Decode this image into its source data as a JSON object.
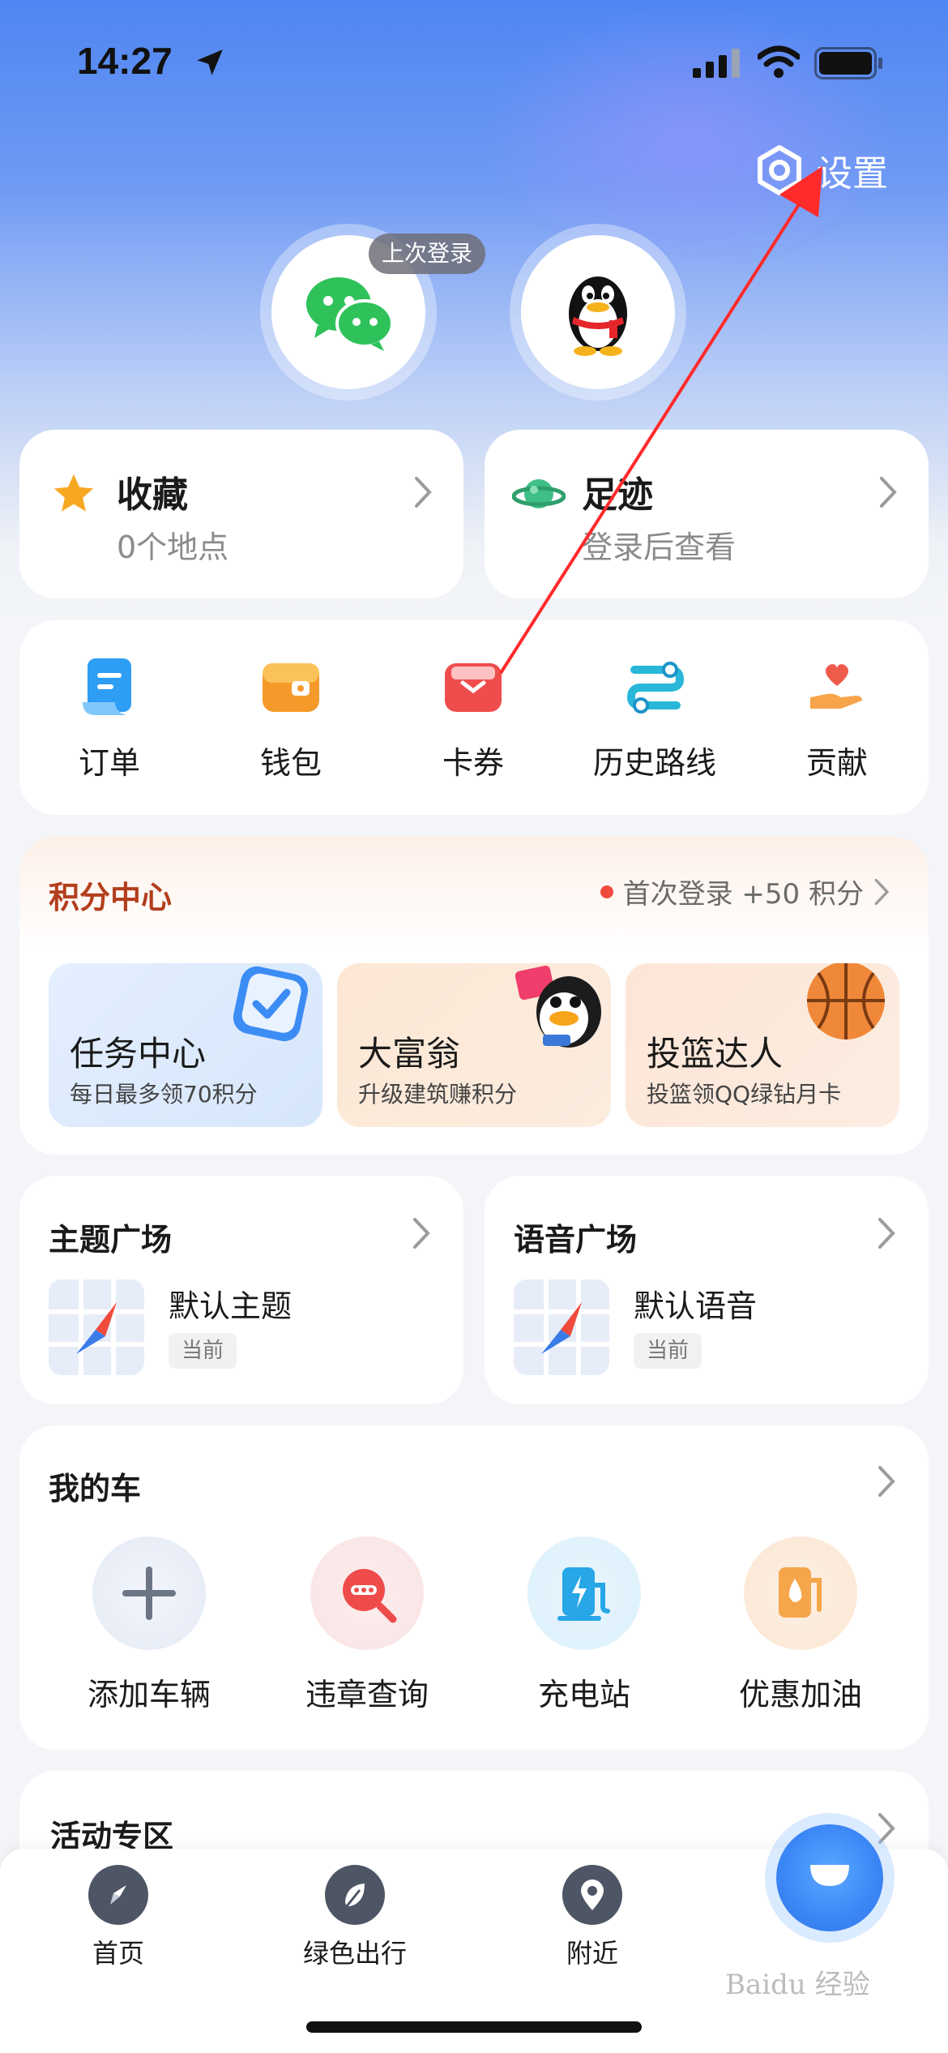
{
  "status_bar": {
    "time": "14:27"
  },
  "header": {
    "settings_label": "设置"
  },
  "login": {
    "last_login_badge": "上次登录",
    "wechat_icon": "wechat-icon",
    "qq_icon": "qq-penguin-icon"
  },
  "favorites": {
    "title": "收藏",
    "subtitle": "0个地点"
  },
  "footprint": {
    "title": "足迹",
    "subtitle": "登录后查看"
  },
  "quick_actions": [
    {
      "label": "订单",
      "icon": "order-icon"
    },
    {
      "label": "钱包",
      "icon": "wallet-icon"
    },
    {
      "label": "卡券",
      "icon": "coupon-icon"
    },
    {
      "label": "历史路线",
      "icon": "route-history-icon"
    },
    {
      "label": "贡献",
      "icon": "contribute-icon"
    }
  ],
  "points": {
    "title": "积分中心",
    "promo": "首次登录 +50 积分",
    "tiles": [
      {
        "title": "任务中心",
        "subtitle": "每日最多领70积分"
      },
      {
        "title": "大富翁",
        "subtitle": "升级建筑赚积分"
      },
      {
        "title": "投篮达人",
        "subtitle": "投篮领QQ绿钻月卡"
      }
    ]
  },
  "theme_square": {
    "title": "主题广场",
    "item_name": "默认主题",
    "tag": "当前"
  },
  "voice_square": {
    "title": "语音广场",
    "item_name": "默认语音",
    "tag": "当前"
  },
  "my_car": {
    "title": "我的车",
    "items": [
      {
        "label": "添加车辆",
        "icon": "plus-icon"
      },
      {
        "label": "违章查询",
        "icon": "violation-search-icon"
      },
      {
        "label": "充电站",
        "icon": "charging-station-icon"
      },
      {
        "label": "优惠加油",
        "icon": "fuel-icon"
      }
    ]
  },
  "activity": {
    "title": "活动专区"
  },
  "tabbar": {
    "items": [
      {
        "label": "首页",
        "icon": "compass-icon"
      },
      {
        "label": "绿色出行",
        "icon": "leaf-icon"
      },
      {
        "label": "附近",
        "icon": "location-pin-icon"
      }
    ]
  },
  "watermark": "Baidu 经验",
  "colors": {
    "accent_blue": "#3b86f6",
    "points_title": "#b33e1c",
    "annotation_arrow": "#ff2a2a"
  }
}
